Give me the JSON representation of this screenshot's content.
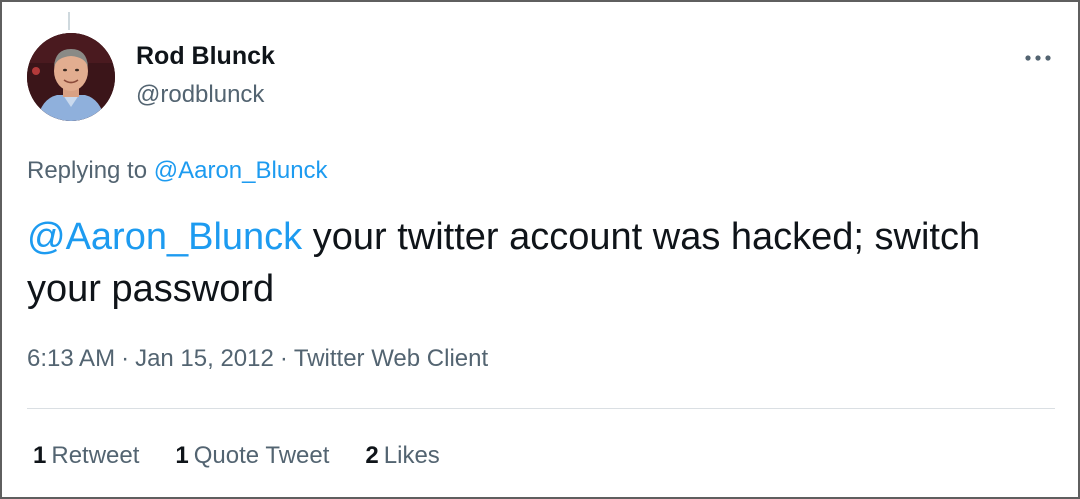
{
  "tweet": {
    "author": {
      "display_name": "Rod Blunck",
      "handle": "@rodblunck"
    },
    "more_icon": "more-horizontal-icon",
    "replying": {
      "prefix": "Replying to",
      "target": "@Aaron_Blunck"
    },
    "text": {
      "mention": "@Aaron_Blunck",
      "body": " your twitter account was hacked; switch your password"
    },
    "meta": {
      "time": "6:13 AM",
      "separator": "·",
      "date": "Jan 15, 2012",
      "client": "Twitter Web Client"
    },
    "stats": [
      {
        "count": "1",
        "label": "Retweet"
      },
      {
        "count": "1",
        "label": "Quote Tweet"
      },
      {
        "count": "2",
        "label": "Likes"
      }
    ]
  },
  "colors": {
    "link": "#1d9bf0",
    "secondary_text": "#536471",
    "primary_text": "#0f1419",
    "border": "#5f5f5f"
  }
}
